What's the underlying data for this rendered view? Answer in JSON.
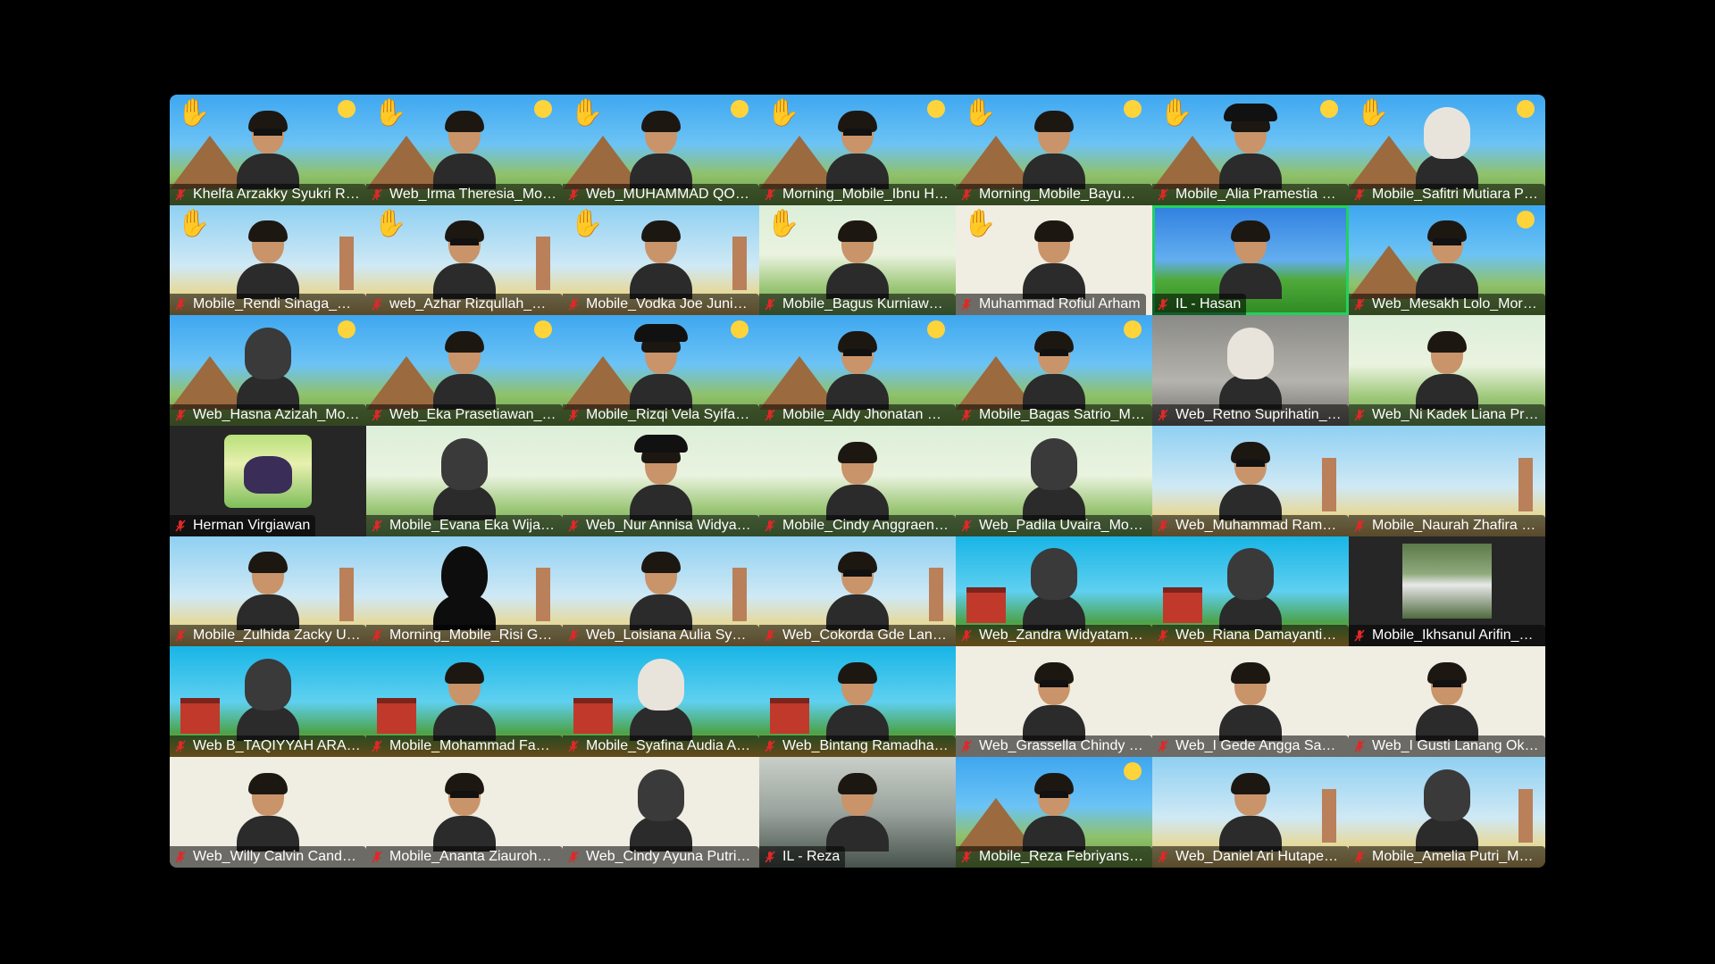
{
  "meeting": {
    "view": "gallery",
    "accent_active_speaker": "#23d160",
    "mute_icon": "muted-microphone-icon",
    "raise_hand_icon": "raised-hand-icon"
  },
  "participants": [
    {
      "name": "Khelfa Arzakky Syukri Ro...",
      "bg": "sky",
      "hand": true,
      "look": "glasses"
    },
    {
      "name": "Web_Irma Theresia_Morn...",
      "bg": "sky",
      "hand": true,
      "look": "long-hair"
    },
    {
      "name": "Web_MUHAMMAD QOH...",
      "bg": "sky",
      "hand": true,
      "look": "plain"
    },
    {
      "name": "Morning_Mobile_Ibnu Ha...",
      "bg": "sky",
      "hand": true,
      "look": "glasses"
    },
    {
      "name": "Morning_Mobile_BayuMa...",
      "bg": "sky",
      "hand": true,
      "look": "plain"
    },
    {
      "name": "Mobile_Alia Pramestia Nu...",
      "bg": "sky",
      "hand": true,
      "look": "hat"
    },
    {
      "name": "Mobile_Safitri Mutiara Pu...",
      "bg": "sky",
      "hand": true,
      "look": "hijab-light"
    },
    {
      "name": "Mobile_Rendi Sinaga_Mo...",
      "bg": "farm",
      "hand": true,
      "look": "plain"
    },
    {
      "name": "web_Azhar Rizqullah_mo...",
      "bg": "farm",
      "hand": true,
      "look": "glasses"
    },
    {
      "name": "Mobile_Vodka Joe Junior_...",
      "bg": "farm",
      "hand": true,
      "look": "plain"
    },
    {
      "name": "Mobile_Bagus Kurniawan...",
      "bg": "mahameru",
      "hand": true,
      "look": "plain"
    },
    {
      "name": "Muhammad Rofiul Arham",
      "bg": "grofy",
      "hand": true,
      "look": "plain"
    },
    {
      "name": "IL - Hasan",
      "bg": "xp",
      "hand": false,
      "look": "plain",
      "active": true
    },
    {
      "name": "Web_Mesakh Lolo_Morni...",
      "bg": "sky",
      "hand": false,
      "look": "glasses"
    },
    {
      "name": "Web_Hasna Azizah_Morni...",
      "bg": "sky",
      "hand": false,
      "look": "hijab"
    },
    {
      "name": "Web_Eka Prasetiawan_M...",
      "bg": "sky",
      "hand": false,
      "look": "plain"
    },
    {
      "name": "Mobile_Rizqi Vela Syifa_...",
      "bg": "sky",
      "hand": false,
      "look": "hat"
    },
    {
      "name": "Mobile_Aldy Jhonatan Hu...",
      "bg": "sky",
      "hand": false,
      "look": "glasses"
    },
    {
      "name": "Mobile_Bagas Satrio_Mor...",
      "bg": "sky",
      "hand": false,
      "look": "glasses"
    },
    {
      "name": "Web_Retno Suprihatin_M...",
      "bg": "room",
      "hand": false,
      "look": "hijab-light"
    },
    {
      "name": "Web_Ni Kadek Liana Prati...",
      "bg": "mahameru",
      "hand": false,
      "look": "long-hair"
    },
    {
      "name": "Herman Virgiawan",
      "bg": "dark",
      "hand": false,
      "look": "panther"
    },
    {
      "name": "Mobile_Evana Eka Wijaya...",
      "bg": "mahameru",
      "hand": false,
      "look": "hijab"
    },
    {
      "name": "Web_Nur Annisa Widya P...",
      "bg": "mahameru",
      "hand": false,
      "look": "hat"
    },
    {
      "name": "Mobile_Cindy Anggraeni_...",
      "bg": "mahameru",
      "hand": false,
      "look": "long-hair"
    },
    {
      "name": "Web_Padila Uvaira_Morni...",
      "bg": "mahameru",
      "hand": false,
      "look": "hijab"
    },
    {
      "name": "Web_Muhammad Ramad...",
      "bg": "farm",
      "hand": false,
      "look": "glasses"
    },
    {
      "name": "Mobile_Naurah Zhafira H...",
      "bg": "farm",
      "hand": false,
      "look": "none"
    },
    {
      "name": "Mobile_Zulhida Zacky Ulc...",
      "bg": "farm",
      "hand": false,
      "look": "plain"
    },
    {
      "name": "Morning_Mobile_Risi Gus...",
      "bg": "farm",
      "hand": false,
      "look": "silhouette"
    },
    {
      "name": "Web_Loisiana Aulia Syahi...",
      "bg": "farm",
      "hand": false,
      "look": "long-hair"
    },
    {
      "name": "Web_Cokorda Gde Lanan...",
      "bg": "farm",
      "hand": false,
      "look": "glasses"
    },
    {
      "name": "Web_Zandra Widyatamak...",
      "bg": "barn",
      "hand": false,
      "look": "hijab"
    },
    {
      "name": "Web_Riana Damayanti_M...",
      "bg": "barn",
      "hand": false,
      "look": "hijab"
    },
    {
      "name": "Mobile_Ikhsanul Arifin_M...",
      "bg": "dark",
      "hand": false,
      "look": "photo"
    },
    {
      "name": "Web B_TAQIYYAH ARAFA...",
      "bg": "barn",
      "hand": false,
      "look": "hijab"
    },
    {
      "name": "Mobile_Mohammad Faqi...",
      "bg": "barn",
      "hand": false,
      "look": "plain"
    },
    {
      "name": "Mobile_Syafina Audia Aki...",
      "bg": "barn",
      "hand": false,
      "look": "hijab-light"
    },
    {
      "name": "Web_Bintang Ramadhan_...",
      "bg": "barn",
      "hand": false,
      "look": "plain"
    },
    {
      "name": "Web_Grassella Chindy Fr...",
      "bg": "grofy",
      "hand": false,
      "look": "glasses"
    },
    {
      "name": "Web_I Gede Angga Saput...",
      "bg": "grofy",
      "hand": false,
      "look": "plain"
    },
    {
      "name": "Web_I Gusti Lanang Oka ...",
      "bg": "grofy",
      "hand": false,
      "look": "glasses"
    },
    {
      "name": "Web_Willy Calvin Candra ...",
      "bg": "grofy",
      "hand": false,
      "look": "plain"
    },
    {
      "name": "Mobile_Ananta Ziaurohm...",
      "bg": "grofy",
      "hand": false,
      "look": "glasses"
    },
    {
      "name": "Web_Cindy Ayuna Putri_...",
      "bg": "grofy",
      "hand": false,
      "look": "hijab"
    },
    {
      "name": "IL - Reza",
      "bg": "outdoor",
      "hand": false,
      "look": "plain"
    },
    {
      "name": "Mobile_Reza Febriyansya...",
      "bg": "sky",
      "hand": false,
      "look": "glasses"
    },
    {
      "name": "Web_Daniel Ari Hutapea_...",
      "bg": "farm",
      "hand": false,
      "look": "plain"
    },
    {
      "name": "Mobile_Amelia Putri_Mor...",
      "bg": "farm",
      "hand": false,
      "look": "hijab"
    }
  ]
}
